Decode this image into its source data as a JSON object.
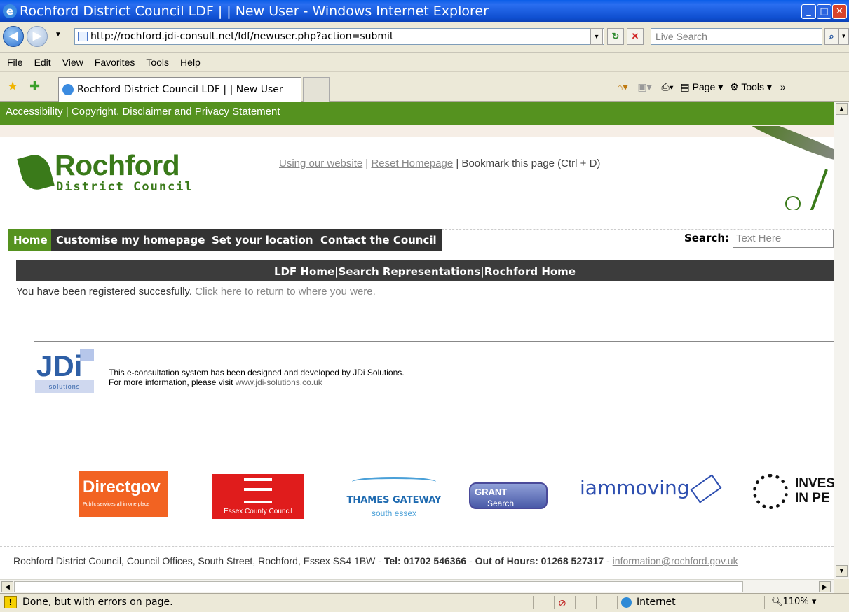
{
  "window": {
    "title": "Rochford District Council LDF | | New User - Windows Internet Explorer",
    "min": "_",
    "max": "□",
    "close": "✕"
  },
  "address": {
    "url": "http://rochford.jdi-consult.net/ldf/newuser.php?action=submit",
    "search_placeholder": "Live Search"
  },
  "menu": [
    "File",
    "Edit",
    "View",
    "Favorites",
    "Tools",
    "Help"
  ],
  "tab": {
    "label": "Rochford District Council LDF | | New User"
  },
  "commands": {
    "page": "Page",
    "tools": "Tools"
  },
  "page": {
    "topbar": "Accessibility | Copyright, Disclaimer and Privacy Statement",
    "logo_name": "Rochford",
    "logo_sub": "District Council",
    "toplinks": {
      "using": "Using our website",
      "sep1": " | ",
      "reset": "Reset Homepage",
      "bookmark": " | Bookmark this page (Ctrl + D)"
    },
    "nav": [
      "Home",
      "Customise my homepage",
      "Set your location",
      "Contact the Council"
    ],
    "search_label": "Search:",
    "search_placeholder": "Text Here",
    "ldf_bar": "LDF Home|Search Representations|Rochford Home",
    "message": "You have been registered succesfully.",
    "message_link": "Click here to return to where you were.",
    "jdi": {
      "logo": "JDi",
      "logo_sub": "solutions",
      "line1": "This e-consultation system has been designed and developed by JDi Solutions.",
      "line2": "For more information, please visit",
      "link": "www.jdi-solutions.co.uk"
    },
    "logos": {
      "directgov": "Directgov",
      "directgov_sub": "Public services all in one place",
      "essex": "Essex County Council",
      "thames": "THAMES GATEWAY",
      "thames_sub": "south essex",
      "grant": "GRANT",
      "grant_sub": "Search",
      "iammoving": "iammoving",
      "invest": "INVES\nIN PE"
    },
    "footer": {
      "address": "Rochford District Council, Council Offices, South Street, Rochford, Essex SS4 1BW - ",
      "tel": "Tel: 01702 546366",
      "sep": " - ",
      "ooh": "Out of Hours: 01268 527317",
      "sep2": " - ",
      "email": "information@rochford.gov.uk"
    }
  },
  "status": {
    "text": "Done, but with errors on page.",
    "zone": "Internet",
    "zoom": "110%"
  }
}
